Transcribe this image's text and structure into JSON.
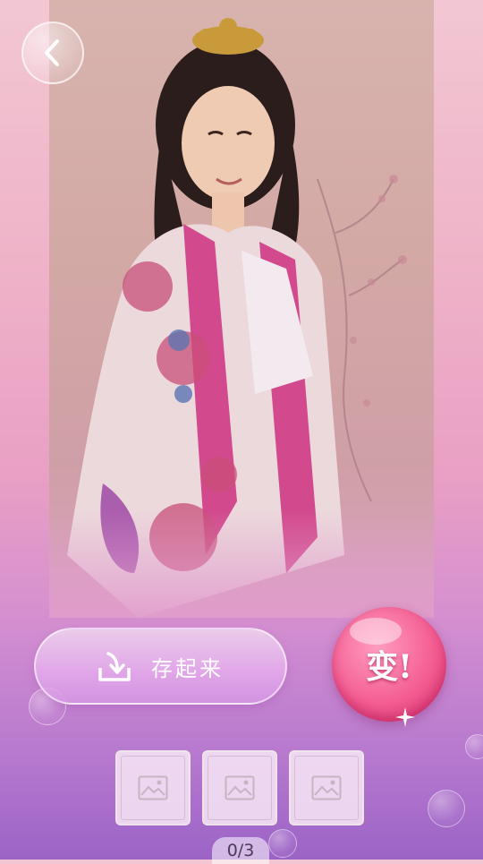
{
  "nav": {
    "back_icon": "chevron-left-icon"
  },
  "photo": {
    "icon": "portrait-photo"
  },
  "actions": {
    "save_label": "存起来",
    "save_icon": "download-icon",
    "change_label": "变!"
  },
  "thumbnails": [
    {
      "icon": "image-placeholder-icon"
    },
    {
      "icon": "image-placeholder-icon"
    },
    {
      "icon": "image-placeholder-icon"
    }
  ],
  "counter": "0/3",
  "colors": {
    "accent": "#f45e93",
    "bg_top": "#f2c7d3",
    "bg_bottom": "#9c63c6"
  }
}
